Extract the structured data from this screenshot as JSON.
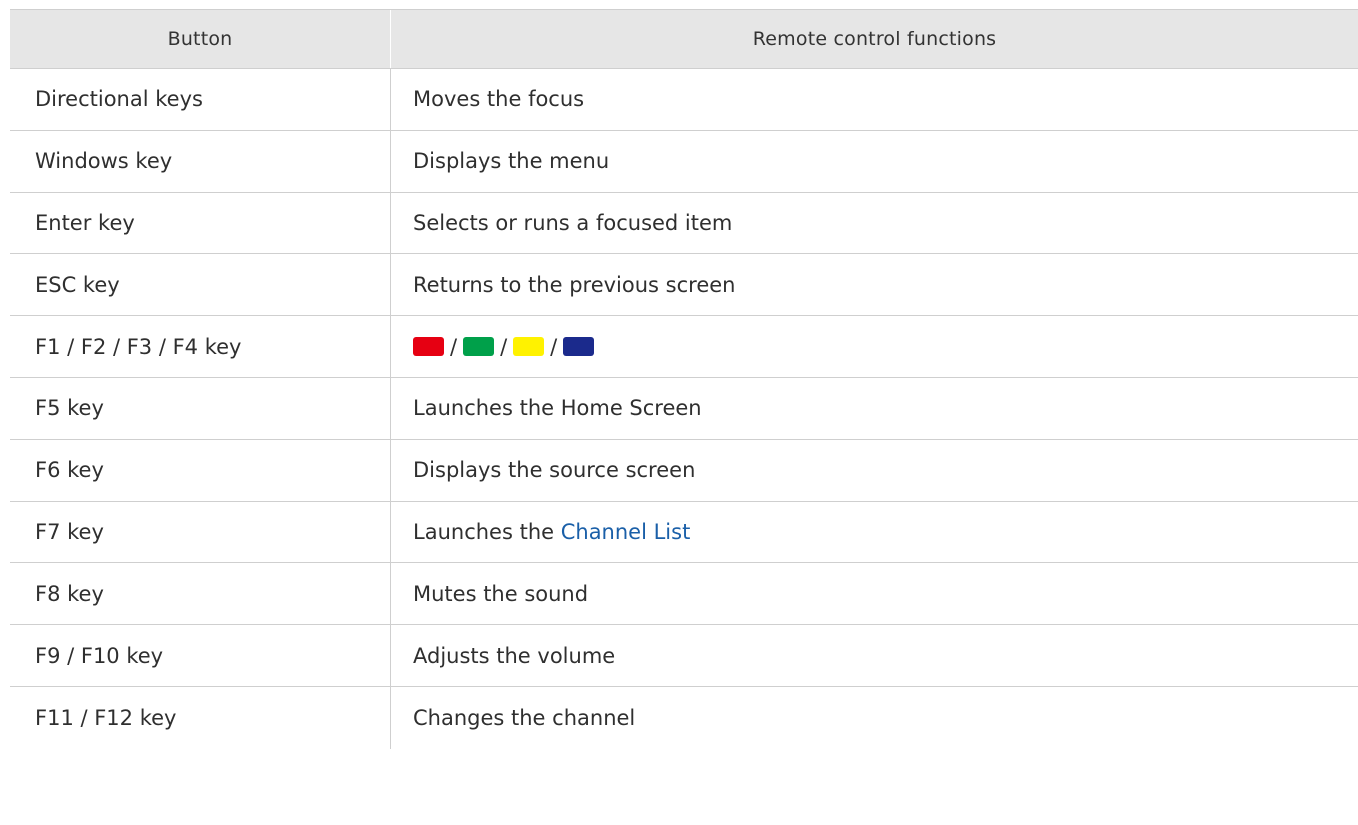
{
  "table": {
    "headers": {
      "button": "Button",
      "functions": "Remote control functions"
    },
    "rows": [
      {
        "button": "Directional keys",
        "function": "Moves the focus"
      },
      {
        "button": "Windows key",
        "function": "Displays the menu"
      },
      {
        "button": "Enter key",
        "function": "Selects or runs a focused item"
      },
      {
        "button": "ESC key",
        "function": "Returns to the previous screen"
      },
      {
        "button": "F1 / F2 / F3 / F4 key",
        "function": "",
        "swatches": [
          {
            "name": "red",
            "color": "#e60012"
          },
          {
            "name": "green",
            "color": "#00a04a"
          },
          {
            "name": "yellow",
            "color": "#fff200"
          },
          {
            "name": "blue",
            "color": "#1b2a8c"
          }
        ],
        "separator": "/"
      },
      {
        "button": "F5 key",
        "function": "Launches the Home Screen"
      },
      {
        "button": "F6 key",
        "function": "Displays the source screen"
      },
      {
        "button": "F7 key",
        "function_prefix": "Launches the ",
        "function_link": "Channel List"
      },
      {
        "button": "F8 key",
        "function": "Mutes the sound"
      },
      {
        "button": "F9 / F10 key",
        "function": "Adjusts the volume"
      },
      {
        "button": "F11 / F12 key",
        "function": "Changes the channel"
      }
    ]
  }
}
